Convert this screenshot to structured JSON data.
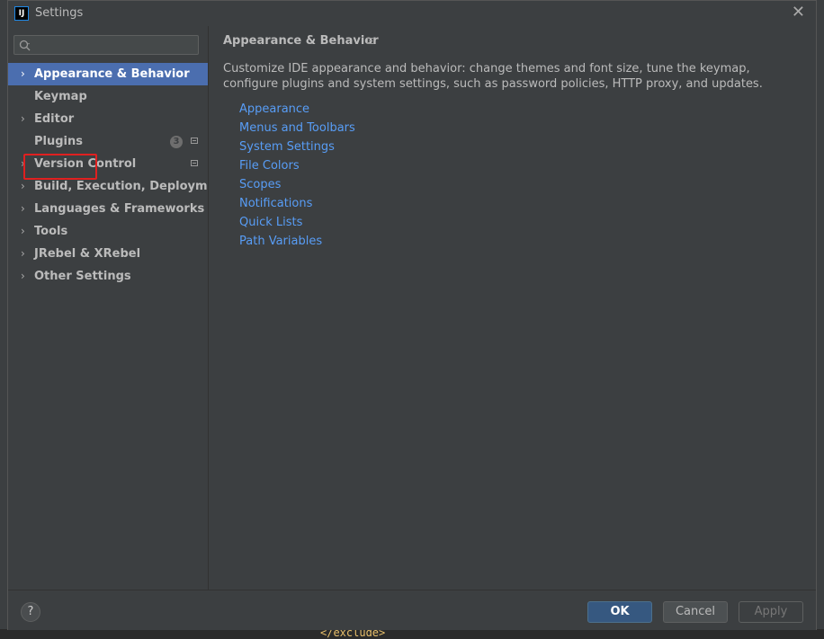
{
  "window": {
    "title": "Settings",
    "app_icon_text": "IJ"
  },
  "search": {
    "placeholder": "",
    "value": ""
  },
  "sidebar": {
    "items": [
      {
        "label": "Appearance & Behavior",
        "expandable": true,
        "selected": true
      },
      {
        "label": "Keymap",
        "expandable": false
      },
      {
        "label": "Editor",
        "expandable": true
      },
      {
        "label": "Plugins",
        "expandable": false,
        "badge": "3"
      },
      {
        "label": "Version Control",
        "expandable": true
      },
      {
        "label": "Build, Execution, Deployment",
        "expandable": true
      },
      {
        "label": "Languages & Frameworks",
        "expandable": true
      },
      {
        "label": "Tools",
        "expandable": true
      },
      {
        "label": "JRebel & XRebel",
        "expandable": true
      },
      {
        "label": "Other Settings",
        "expandable": true
      }
    ]
  },
  "main": {
    "heading": "Appearance & Behavior",
    "description": "Customize IDE appearance and behavior: change themes and font size, tune the keymap, configure plugins and system settings, such as password policies, HTTP proxy, and updates.",
    "links": [
      "Appearance",
      "Menus and Toolbars",
      "System Settings",
      "File Colors",
      "Scopes",
      "Notifications",
      "Quick Lists",
      "Path Variables"
    ]
  },
  "footer": {
    "help": "?",
    "ok": "OK",
    "cancel": "Cancel",
    "apply": "Apply"
  },
  "background": {
    "code_text": "</exclude>"
  },
  "colors": {
    "accent": "#4b6eaf",
    "link": "#589df6",
    "highlight": "#e02020",
    "panel": "#3c3f41"
  }
}
